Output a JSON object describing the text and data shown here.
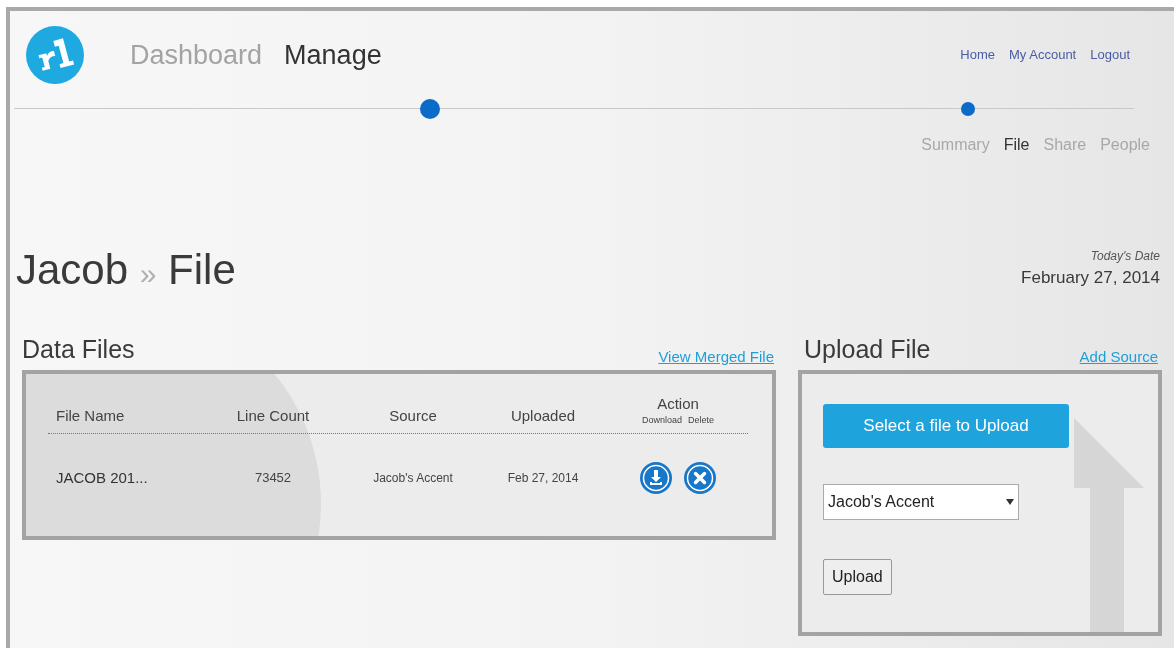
{
  "main_nav": [
    {
      "label": "Dashboard",
      "selected": false
    },
    {
      "label": "Manage",
      "selected": true
    }
  ],
  "top_links": [
    "Home",
    "My Account",
    "Logout"
  ],
  "sub_nav": [
    {
      "label": "Summary",
      "selected": false
    },
    {
      "label": "File",
      "selected": true
    },
    {
      "label": "Share",
      "selected": false
    },
    {
      "label": "People",
      "selected": false
    }
  ],
  "page_title": {
    "name": "Jacob",
    "separator": "»",
    "section": "File"
  },
  "date": {
    "label": "Today's Date",
    "value": "February 27, 2014"
  },
  "data_files": {
    "title": "Data Files",
    "link": "View Merged File",
    "columns": [
      "File Name",
      "Line Count",
      "Source",
      "Uploaded"
    ],
    "action_column": {
      "title": "Action",
      "sub_labels": [
        "Download",
        "Delete"
      ]
    },
    "rows": [
      {
        "file_name": "JACOB 201...",
        "line_count": "73452",
        "source": "Jacob's Accent",
        "uploaded": "Feb 27, 2014"
      }
    ]
  },
  "upload_file": {
    "title": "Upload File",
    "link": "Add Source",
    "select_button": "Select a file to Upload",
    "source_select": "Jacob's Accent",
    "upload_button": "Upload"
  }
}
